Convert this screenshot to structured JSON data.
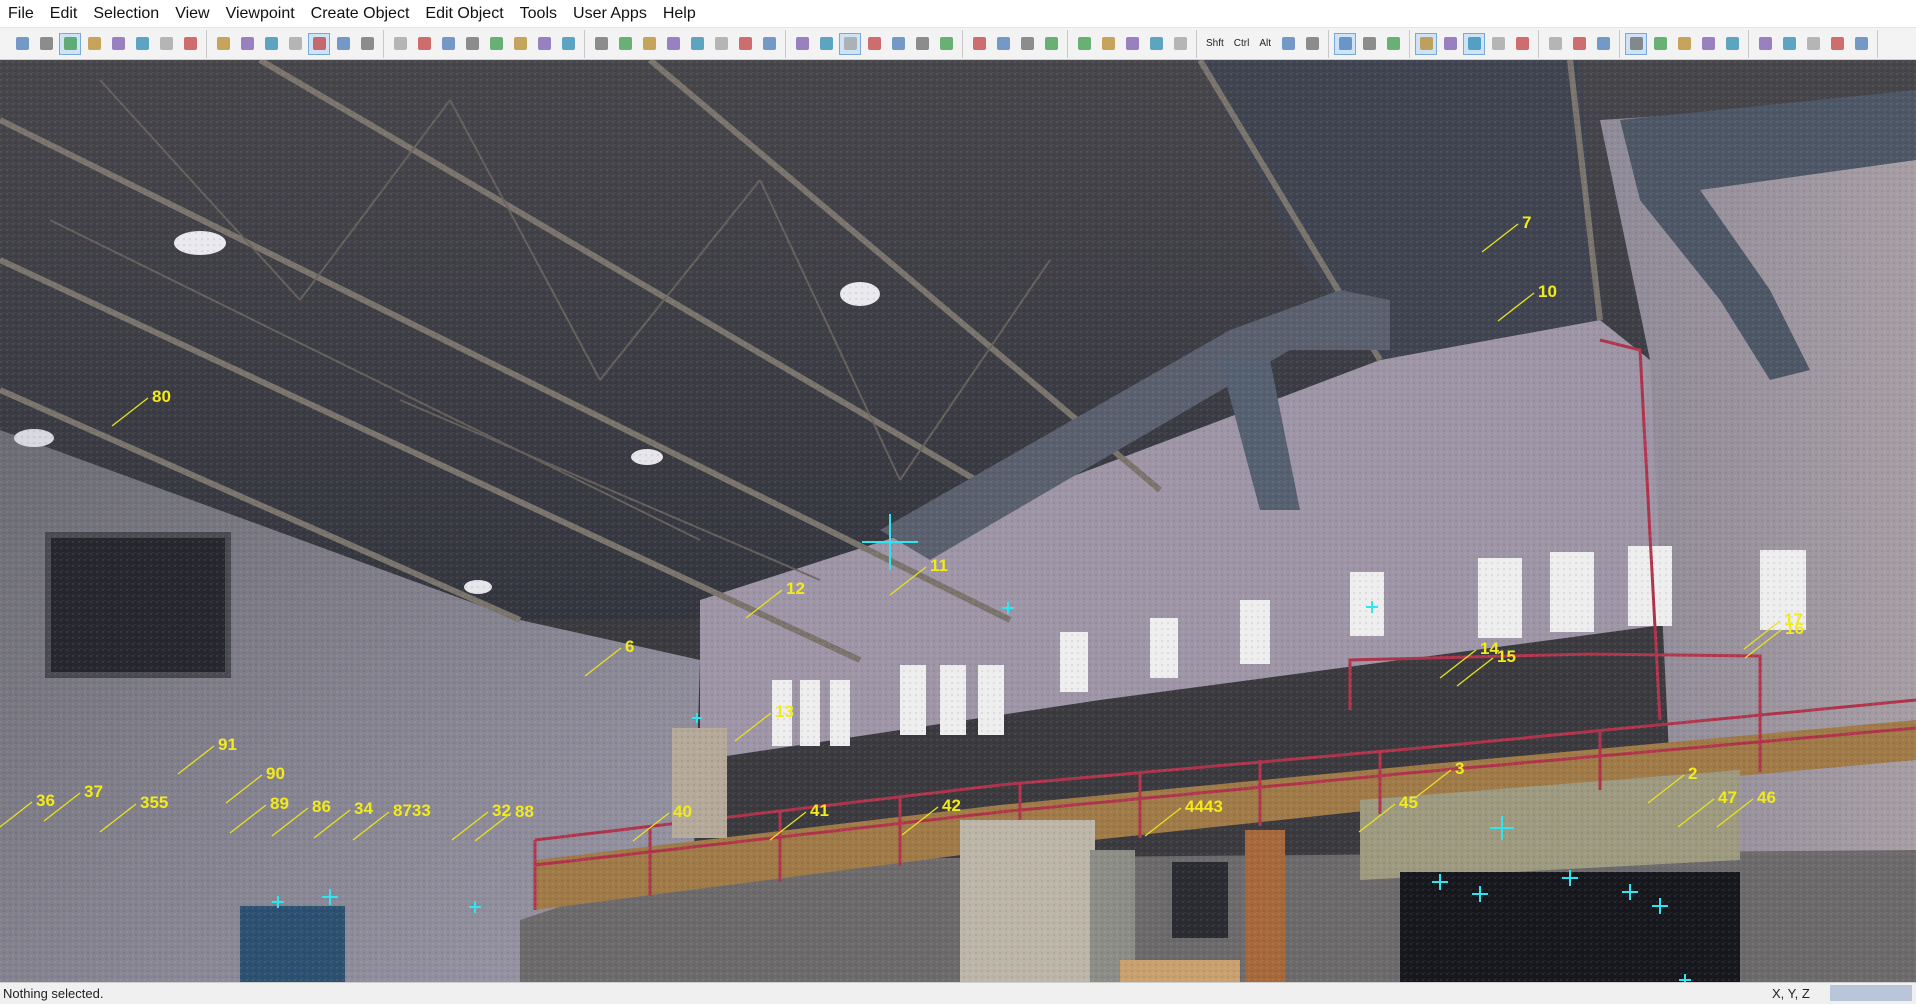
{
  "menu": [
    "File",
    "Edit",
    "Selection",
    "View",
    "Viewpoint",
    "Create Object",
    "Edit Object",
    "Tools",
    "User Apps",
    "Help"
  ],
  "toolbar": {
    "groups": [
      {
        "buttons": [
          {
            "icon": "select-arrow-icon"
          },
          {
            "icon": "select-plus-icon"
          },
          {
            "icon": "pan-hand-icon",
            "active": true
          },
          {
            "icon": "fence-select-icon"
          },
          {
            "icon": "pencil-icon"
          },
          {
            "icon": "move-cross-icon"
          },
          {
            "icon": "rotate-icon"
          },
          {
            "icon": "orbit-icon"
          }
        ]
      },
      {
        "buttons": [
          {
            "icon": "polygon-select-icon"
          },
          {
            "icon": "rectangle-select-icon"
          },
          {
            "icon": "circle-select-icon"
          },
          {
            "icon": "ball-icon"
          },
          {
            "icon": "slice-plane-icon",
            "active": true
          },
          {
            "icon": "cube-icon"
          },
          {
            "icon": "rotate-view-icon"
          }
        ]
      },
      {
        "buttons": [
          {
            "icon": "measure-icon"
          },
          {
            "icon": "measure-alt-icon"
          },
          {
            "icon": "zoom-icon"
          },
          {
            "icon": "zoom-out-icon"
          },
          {
            "icon": "zoom-fit-icon"
          },
          {
            "icon": "zoom-window-icon"
          },
          {
            "icon": "globe-icon"
          },
          {
            "icon": "globe-alt-icon"
          }
        ]
      },
      {
        "buttons": [
          {
            "icon": "cloud-icon"
          },
          {
            "icon": "cloud-fit-icon"
          },
          {
            "icon": "cloud-merge-icon"
          },
          {
            "icon": "copy-icon"
          },
          {
            "icon": "paste-icon"
          },
          {
            "icon": "paint-icon"
          },
          {
            "icon": "brush-icon"
          },
          {
            "icon": "eraser-icon"
          }
        ]
      },
      {
        "buttons": [
          {
            "icon": "layers-icon"
          },
          {
            "icon": "properties-icon"
          },
          {
            "icon": "highlight-icon",
            "active": true
          },
          {
            "icon": "grid-icon"
          },
          {
            "icon": "sphere-icon"
          },
          {
            "icon": "points-icon"
          },
          {
            "icon": "points-alt-icon"
          }
        ]
      },
      {
        "buttons": [
          {
            "icon": "walk-icon"
          },
          {
            "icon": "walk-2-icon"
          },
          {
            "icon": "walk-3-icon"
          },
          {
            "icon": "walk-4-icon"
          }
        ]
      },
      {
        "buttons": [
          {
            "icon": "color-a-icon"
          },
          {
            "icon": "color-b-icon"
          },
          {
            "icon": "color-c-icon"
          },
          {
            "icon": "color-d-icon"
          },
          {
            "icon": "hand-icon"
          }
        ]
      },
      {
        "buttons": [
          {
            "label": "Shft"
          },
          {
            "label": "Ctrl"
          },
          {
            "label": "Alt"
          },
          {
            "icon": "mouse-left-icon"
          },
          {
            "icon": "mouse-right-icon"
          }
        ]
      },
      {
        "buttons": [
          {
            "icon": "scan-icon",
            "active": true
          },
          {
            "icon": "scan-grid-icon"
          },
          {
            "icon": "scan-list-icon"
          }
        ]
      },
      {
        "buttons": [
          {
            "icon": "view-a-icon",
            "active": true
          },
          {
            "icon": "view-b-icon"
          },
          {
            "icon": "view-c-icon",
            "active": true
          },
          {
            "icon": "view-d-icon"
          },
          {
            "icon": "target-icon"
          }
        ]
      },
      {
        "buttons": [
          {
            "icon": "matrix-icon"
          },
          {
            "icon": "matrix-alt-icon"
          },
          {
            "icon": "record-icon"
          }
        ]
      },
      {
        "buttons": [
          {
            "icon": "bar-1-icon",
            "active": true
          },
          {
            "icon": "bar-2-icon"
          },
          {
            "icon": "bar-3-icon"
          },
          {
            "icon": "bar-4-icon"
          },
          {
            "icon": "bar-5-icon"
          }
        ]
      },
      {
        "buttons": [
          {
            "icon": "undo-icon"
          },
          {
            "icon": "redo-icon"
          },
          {
            "icon": "cut-icon"
          },
          {
            "icon": "paste-clip-icon"
          },
          {
            "icon": "close-x-icon"
          }
        ]
      }
    ]
  },
  "viewport": {
    "scene": "laser-scan point cloud of an industrial hall interior",
    "labels": [
      "80",
      "7",
      "10",
      "11",
      "12",
      "6",
      "13",
      "14",
      "15",
      "17",
      "16",
      "91",
      "90",
      "89",
      "86",
      "34",
      "8733",
      "32",
      "88",
      "36",
      "37",
      "355",
      "40",
      "41",
      "42",
      "4443",
      "45",
      "3",
      "2",
      "47",
      "46"
    ]
  },
  "status": {
    "text": "Nothing selected.",
    "coords_label": "X, Y, Z"
  }
}
